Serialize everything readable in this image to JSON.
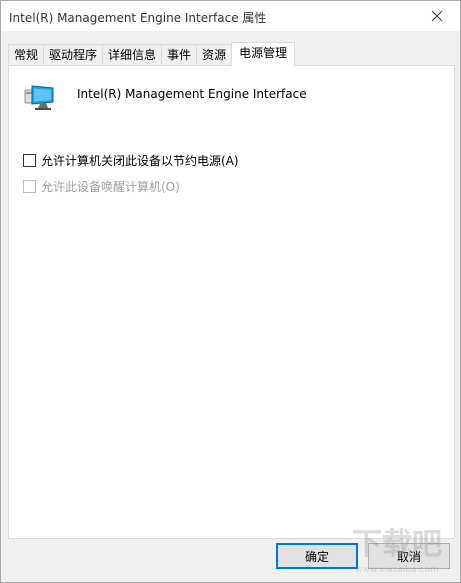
{
  "window": {
    "title": "Intel(R) Management Engine Interface   属性",
    "close_icon": "close-icon"
  },
  "tabs": [
    {
      "label": "常规",
      "active": false
    },
    {
      "label": "驱动程序",
      "active": false
    },
    {
      "label": "详细信息",
      "active": false
    },
    {
      "label": "事件",
      "active": false
    },
    {
      "label": "资源",
      "active": false
    },
    {
      "label": "电源管理",
      "active": true
    }
  ],
  "device": {
    "icon": "monitor-icon",
    "name": "Intel(R) Management Engine Interface"
  },
  "options": {
    "allow_turn_off": {
      "label": "允许计算机关闭此设备以节约电源(A)",
      "checked": false,
      "enabled": true
    },
    "allow_wake": {
      "label": "允许此设备唤醒计算机(O)",
      "checked": false,
      "enabled": false
    }
  },
  "buttons": {
    "ok": "确定",
    "cancel": "取消"
  },
  "colors": {
    "accent": "#0078d7",
    "panel_bg": "#f0f0f0",
    "disabled_text": "#a0a0a0"
  },
  "watermark": {
    "text": "下载吧",
    "url": "www.xiazaiba.com"
  }
}
